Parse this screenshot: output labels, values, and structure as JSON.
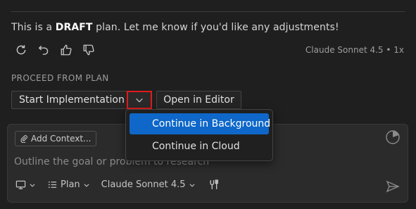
{
  "message": {
    "prefix": "This is a ",
    "bold": "DRAFT",
    "suffix": " plan. Let me know if you'd like any adjustments!"
  },
  "meta": {
    "model_info": "Claude Sonnet 4.5 • 1x"
  },
  "actions": [
    "retry-icon",
    "undo-icon",
    "thumbs-up-icon",
    "thumbs-down-icon"
  ],
  "proceed": {
    "section_label": "PROCEED FROM PLAN",
    "start_label": "Start Implementation",
    "open_editor_label": "Open in Editor"
  },
  "dropdown": {
    "items": [
      {
        "label": "Continue in Background",
        "active": true
      },
      {
        "label": "Continue in Cloud",
        "active": false
      }
    ]
  },
  "chat": {
    "add_context_label": "Add Context...",
    "placeholder": "Outline the goal or problem to research",
    "mode_label": "Plan",
    "model_label": "Claude Sonnet 4.5"
  },
  "colors": {
    "accent": "#0e67c9",
    "highlight_border": "#e01b1b",
    "background": "#1f1f1f"
  }
}
